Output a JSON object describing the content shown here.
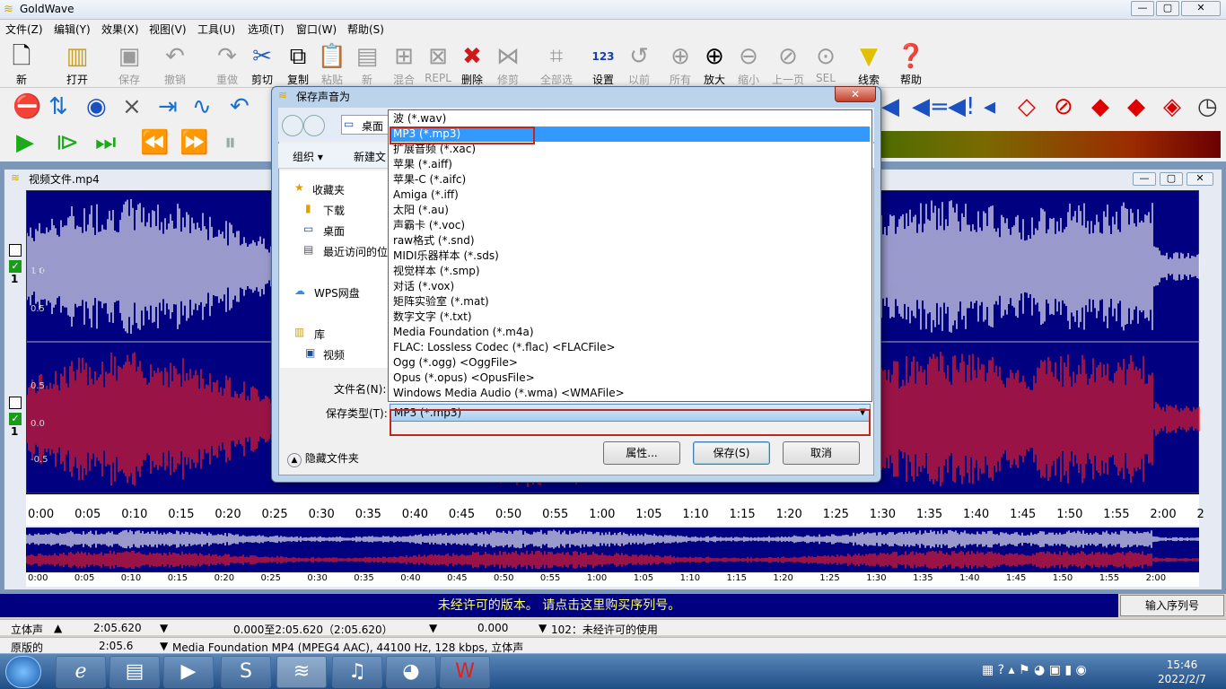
{
  "app": {
    "title": "GoldWave"
  },
  "menu": [
    "文件(Z)",
    "编辑(Y)",
    "效果(X)",
    "视图(V)",
    "工具(U)",
    "选项(T)",
    "窗口(W)",
    "帮助(S)"
  ],
  "toolbar": {
    "new": "新",
    "open": "打开",
    "save": "保存",
    "undo": "撤销",
    "redo": "重做",
    "cut": "剪切",
    "copy": "复制",
    "paste": "粘贴",
    "new2": "新",
    "mix": "混合",
    "repl": "REPL",
    "delete": "删除",
    "trim": "修剪",
    "select_all": "全部选择",
    "set": "设置",
    "prev": "以前",
    "all": "所有",
    "zoom_in": "放大",
    "zoom_out": "缩小",
    "up": "上一页",
    "sel": "SEL",
    "cue": "线索",
    "help": "帮助",
    "set_icon_text": "123"
  },
  "document": {
    "title": "视频文件.mp4"
  },
  "waveform": {
    "left_labels": [
      "1.0",
      "0.5"
    ],
    "right_labels": [
      "0.5",
      "0.0",
      "-0.5"
    ],
    "channel_label": "1"
  },
  "timeline": {
    "ticks": [
      "0:00",
      "0:05",
      "0:10",
      "0:15",
      "0:20",
      "0:25",
      "0:30",
      "0:35",
      "0:40",
      "0:45",
      "0:50",
      "0:55",
      "1:00",
      "1:05",
      "1:10",
      "1:15",
      "1:20",
      "1:25",
      "1:30",
      "1:35",
      "1:40",
      "1:45",
      "1:50",
      "1:55",
      "2:00",
      "2"
    ],
    "overview_ticks": [
      "0:00",
      "0:05",
      "0:10",
      "0:15",
      "0:20",
      "0:25",
      "0:30",
      "0:35",
      "0:40",
      "0:45",
      "0:50",
      "0:55",
      "1:00",
      "1:05",
      "1:10",
      "1:15",
      "1:20",
      "1:25",
      "1:30",
      "1:35",
      "1:40",
      "1:45",
      "1:50",
      "1:55",
      "2:00"
    ]
  },
  "banner": {
    "text": "未经许可的版本。 请点击这里购买序列号。",
    "serial_button": "输入序列号"
  },
  "status": {
    "row1": {
      "mode": "立体声",
      "length": "2:05.620",
      "range": "0.000至2:05.620（2:05.620）",
      "pos": "0.000",
      "msg": "102：未经许可的使用"
    },
    "row2": {
      "mode": "原版的",
      "length": "2:05.6",
      "format": "Media Foundation MP4 (MPEG4 AAC), 44100 Hz, 128 kbps, 立体声"
    }
  },
  "dialog": {
    "title": "保存声音为",
    "location": "桌面",
    "organize": "组织 ▾",
    "new_folder": "新建文",
    "nav": {
      "favorites": "收藏夹",
      "downloads": "下载",
      "desktop": "桌面",
      "recent": "最近访问的位",
      "wps": "WPS网盘",
      "library": "库",
      "video": "视频"
    },
    "filename_label": "文件名(N):",
    "filetype_label": "保存类型(T):",
    "filetype_value": "MP3 (*.mp3)",
    "hide_folders": "隐藏文件夹",
    "buttons": {
      "properties": "属性...",
      "save": "保存(S)",
      "cancel": "取消"
    },
    "options": [
      "波 (*.wav)",
      "MP3 (*.mp3)",
      "扩展音频 (*.xac)",
      "苹果 (*.aiff)",
      "苹果-C (*.aifc)",
      "Amiga (*.iff)",
      "太阳 (*.au)",
      "声霸卡 (*.voc)",
      "raw格式 (*.snd)",
      "MIDI乐器样本 (*.sds)",
      "视觉样本 (*.smp)",
      "对话 (*.vox)",
      "矩阵实验室 (*.mat)",
      "数字文字 (*.txt)",
      "Media Foundation (*.m4a)",
      "FLAC: Lossless Codec (*.flac)    <FLACFile>",
      "Ogg (*.ogg)    <OggFile>",
      "Opus (*.opus)    <OpusFile>",
      "Windows Media Audio (*.wma)    <WMAFile>"
    ],
    "selected_index": 1
  },
  "taskbar": {
    "time": "15:46",
    "date": "2022/2/7"
  }
}
